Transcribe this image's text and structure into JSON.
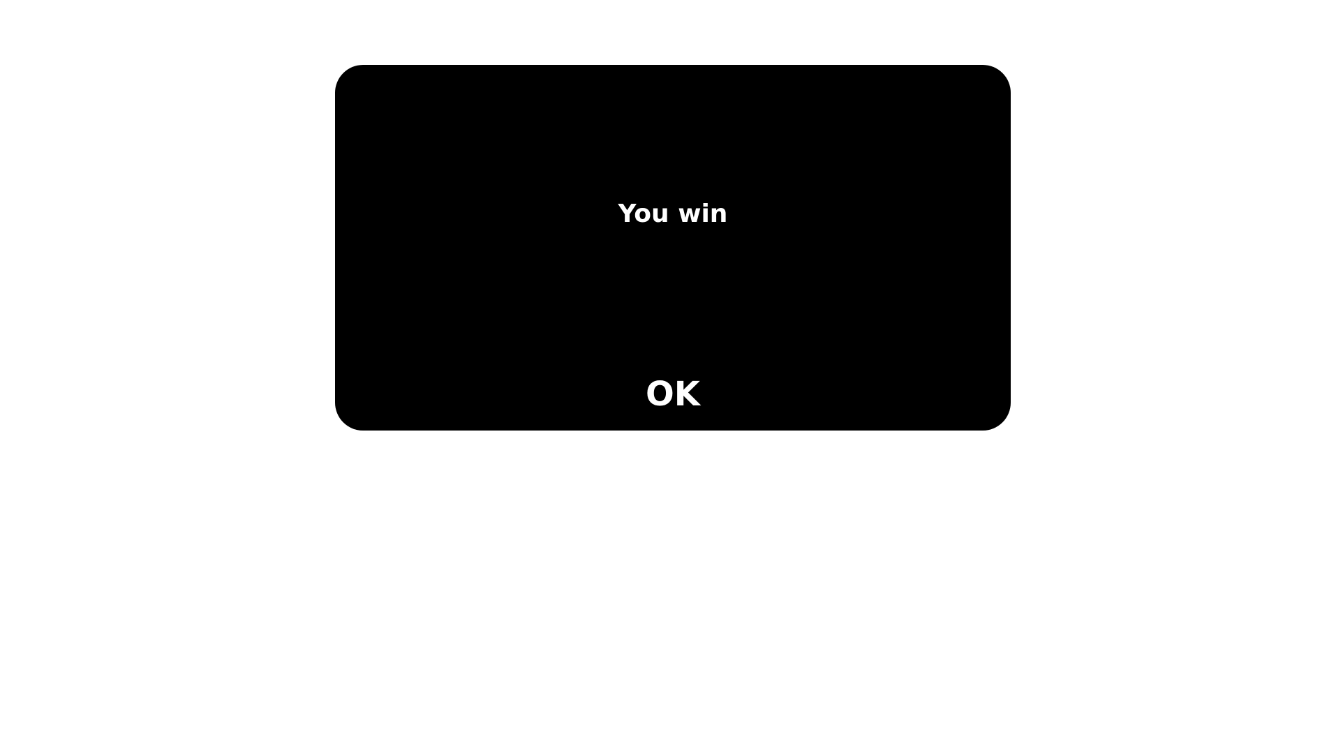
{
  "dialog": {
    "message": "You win",
    "ok_label": "OK"
  },
  "colors": {
    "background": "#ffffff",
    "dialog_background": "#000000",
    "text": "#ffffff"
  }
}
